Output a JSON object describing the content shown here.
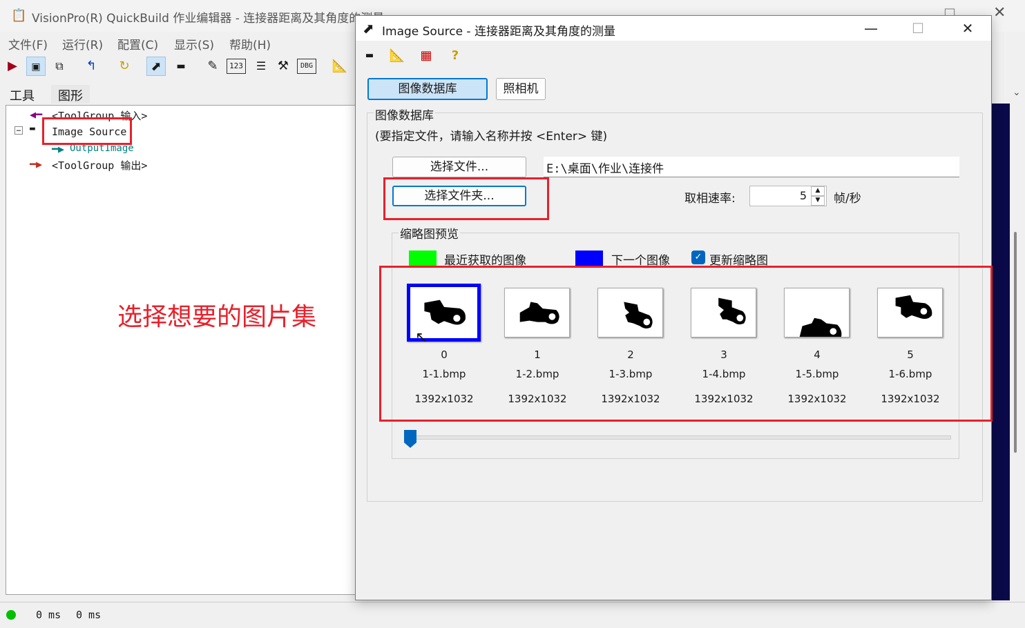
{
  "background_window": {
    "title": "VisionPro(R) QuickBuild 作业编辑器 - 连接器距离及其角度的测量",
    "menu": [
      "文件(F)",
      "运行(R)",
      "配置(C)",
      "显示(S)",
      "帮助(H)"
    ],
    "tabs": [
      "工具",
      "图形"
    ],
    "tree": {
      "input_node": "<ToolGroup 输入>",
      "image_source_node": "Image Source",
      "output_image_node": "OutputImage",
      "output_node": "<ToolGroup 输出>"
    },
    "status": {
      "time1": "0 ms",
      "time2": "0 ms"
    }
  },
  "dialog": {
    "title": "Image Source - 连接器距离及其角度的测量",
    "tabs": {
      "database": "图像数据库",
      "camera": "照相机"
    },
    "group_title": "图像数据库",
    "hint": "(要指定文件，请输入名称并按 <Enter> 键)",
    "select_file_button": "选择文件...",
    "file_path": "E:\\桌面\\作业\\连接件",
    "select_folder_button": "选择文件夹...",
    "rate_label": "取相速率:",
    "rate_value": "5",
    "rate_unit": "帧/秒",
    "thumb_group_title": "缩略图预览",
    "legend_recent": "最近获取的图像",
    "legend_next": "下一个图像",
    "update_thumbs_label": "更新缩略图",
    "update_thumbs_checked": true,
    "thumbnails": [
      {
        "index": "0",
        "file": "1-1.bmp",
        "dims": "1392x1032"
      },
      {
        "index": "1",
        "file": "1-2.bmp",
        "dims": "1392x1032"
      },
      {
        "index": "2",
        "file": "1-3.bmp",
        "dims": "1392x1032"
      },
      {
        "index": "3",
        "file": "1-4.bmp",
        "dims": "1392x1032"
      },
      {
        "index": "4",
        "file": "1-5.bmp",
        "dims": "1392x1032"
      },
      {
        "index": "5",
        "file": "1-6.bmp",
        "dims": "1392x1032"
      }
    ]
  },
  "annotation": "选择想要的图片集",
  "colors": {
    "recent": "#00ff00",
    "next": "#0000ff",
    "annotation": "#e8202a",
    "accent": "#0078d4"
  }
}
